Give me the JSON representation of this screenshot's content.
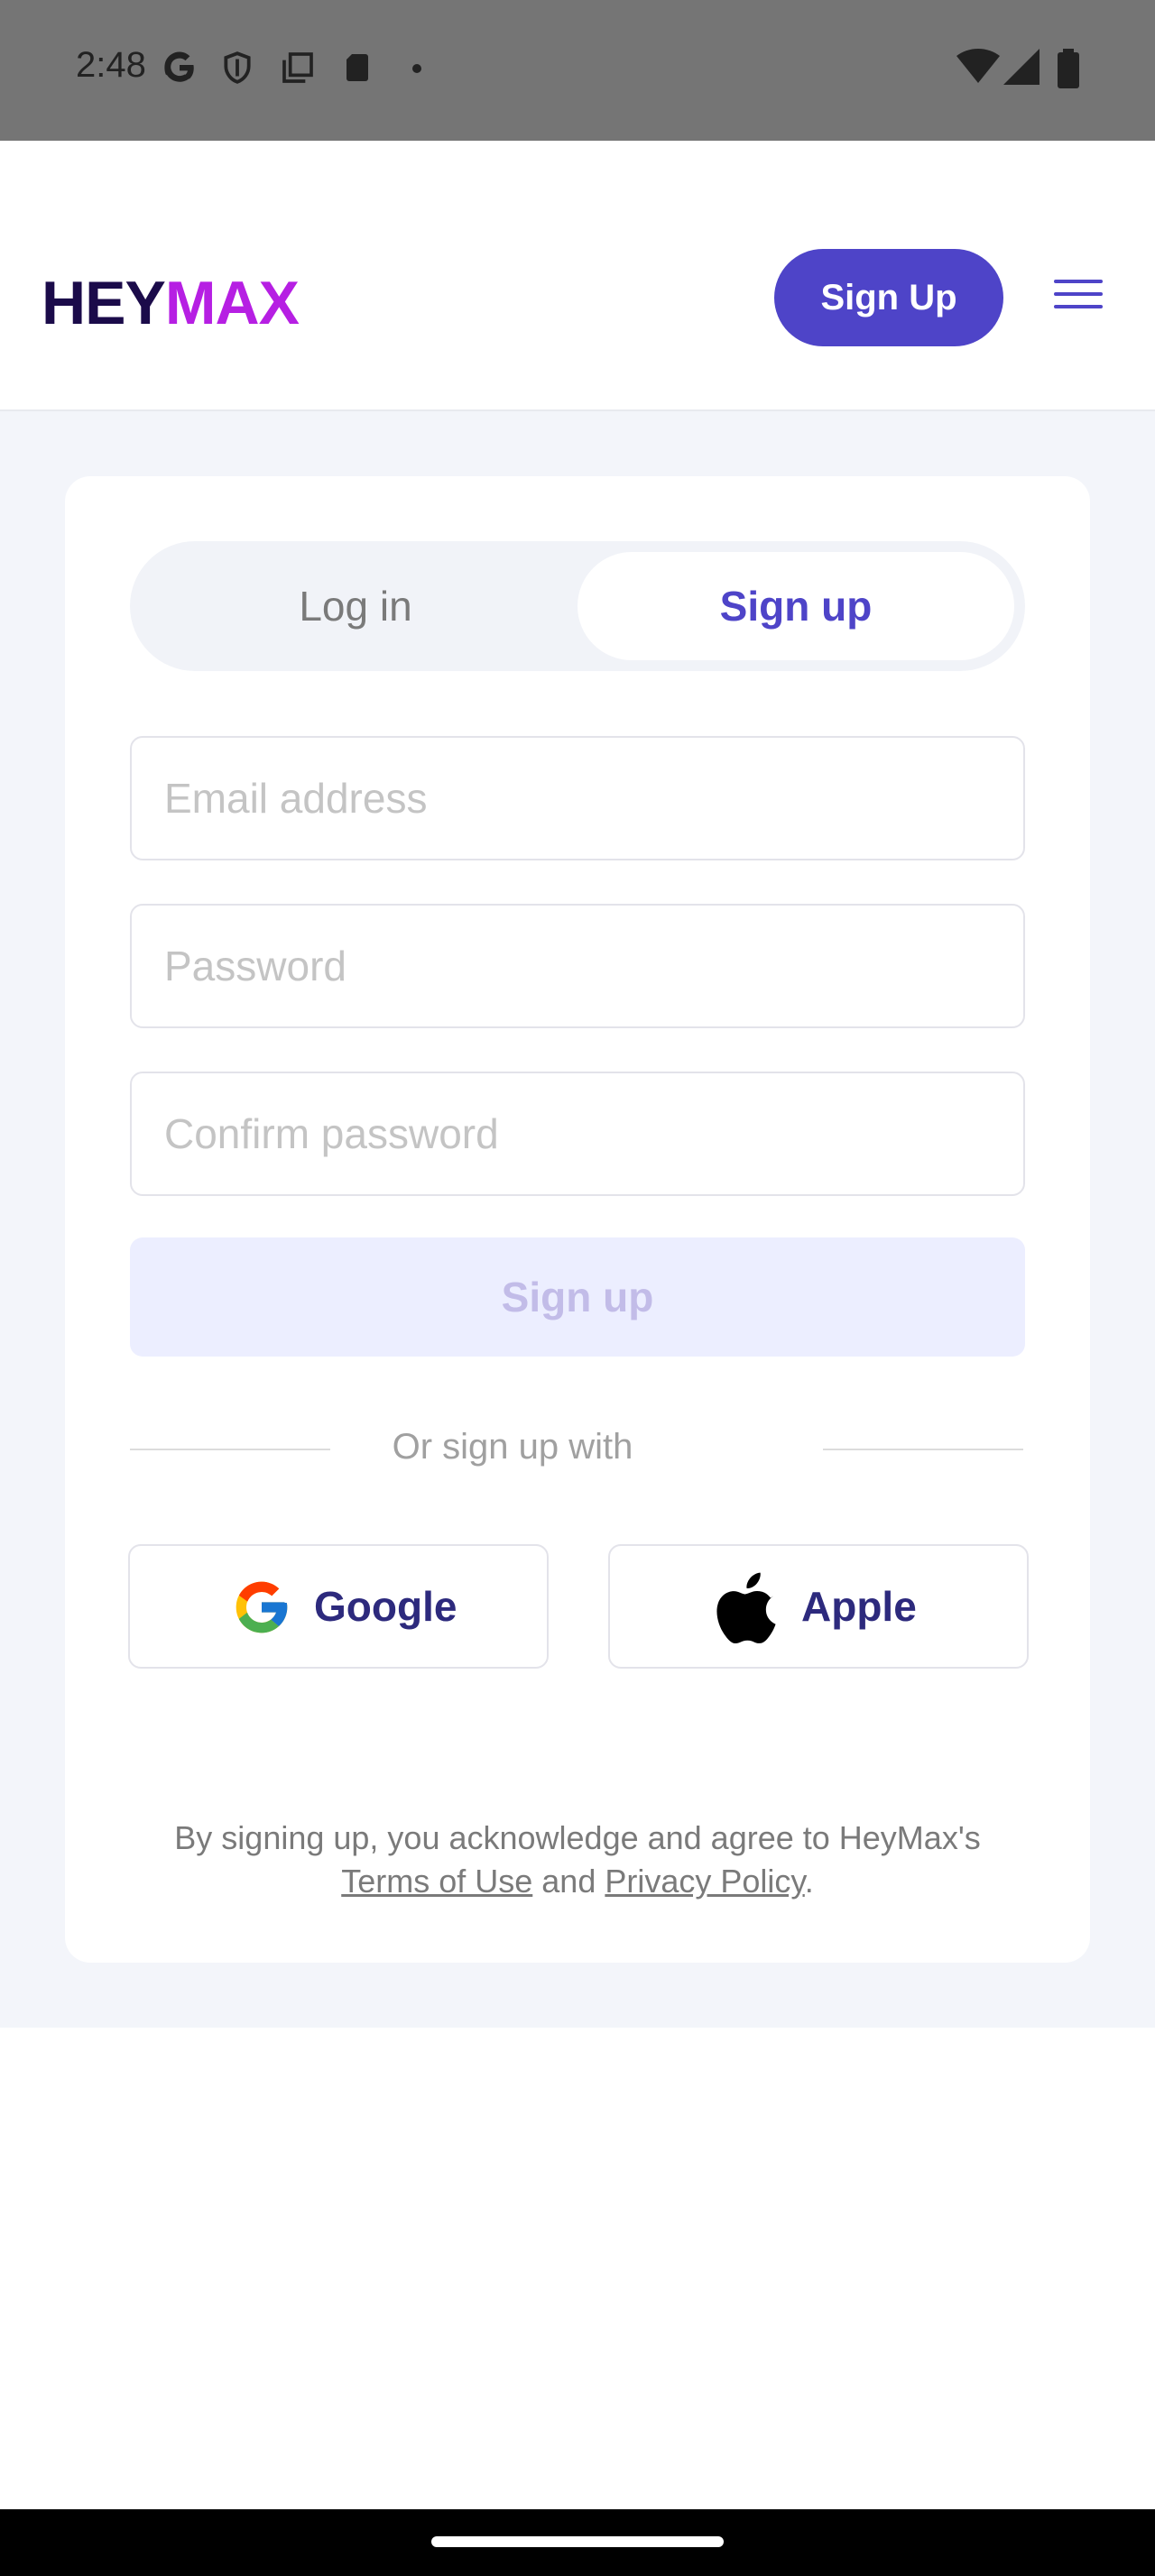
{
  "status_bar": {
    "time": "2:48",
    "icons_left": [
      "google-icon",
      "shield-icon",
      "copy-icon",
      "sd-card-icon",
      "dot-icon"
    ],
    "icons_right": [
      "wifi-icon",
      "signal-icon",
      "battery-icon"
    ]
  },
  "header": {
    "logo_part1": "HEY",
    "logo_part2": "MAX",
    "signup_button": "Sign Up",
    "menu_icon": "menu-icon"
  },
  "auth": {
    "tabs": {
      "login": "Log in",
      "signup": "Sign up",
      "active": "signup"
    },
    "email_placeholder": "Email address",
    "password_placeholder": "Password",
    "confirm_placeholder": "Confirm password",
    "submit_label": "Sign up",
    "divider_text": "Or sign up with",
    "google_label": "Google",
    "apple_label": "Apple",
    "legal_prefix": "By signing up, you acknowledge and agree to HeyMax's",
    "terms_link": "Terms of Use",
    "legal_and": "and",
    "privacy_link": "Privacy Policy",
    "legal_suffix": "."
  },
  "colors": {
    "primary": "#4e44c8",
    "logo_dark": "#1b0b4a",
    "logo_accent": "#b61fe3",
    "page_bg": "#f3f5fa"
  }
}
